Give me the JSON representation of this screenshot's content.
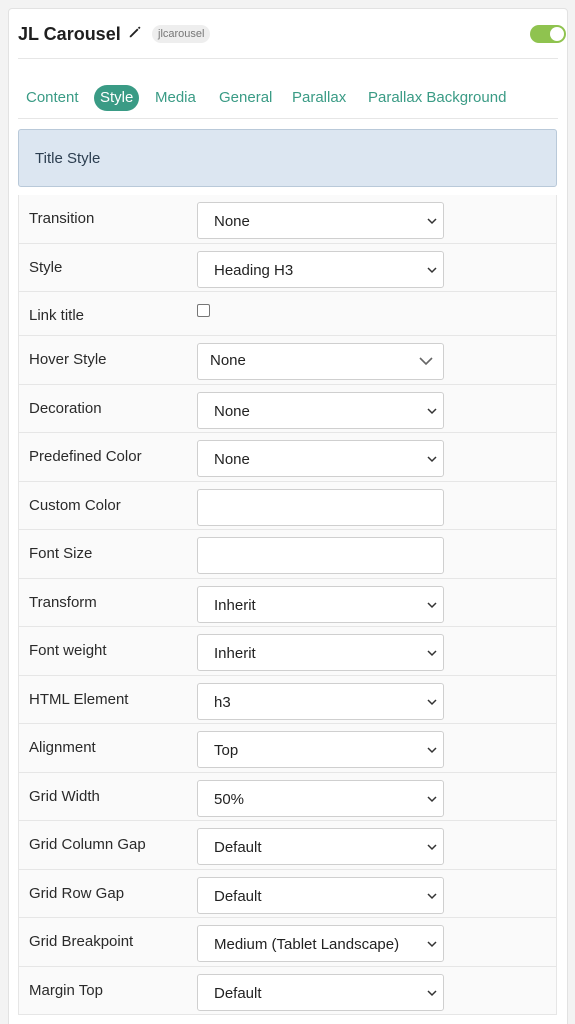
{
  "header": {
    "title": "JL Carousel",
    "alias": "jlcarousel",
    "enabled": true
  },
  "tabs": [
    {
      "label": "Content",
      "active": false
    },
    {
      "label": "Style",
      "active": true
    },
    {
      "label": "Media",
      "active": false
    },
    {
      "label": "General",
      "active": false
    },
    {
      "label": "Parallax",
      "active": false
    },
    {
      "label": "Parallax Background",
      "active": false
    }
  ],
  "section": {
    "title": "Title Style"
  },
  "fields": {
    "transition": {
      "label": "Transition",
      "value": "None"
    },
    "style": {
      "label": "Style",
      "value": "Heading H3"
    },
    "link_title": {
      "label": "Link title",
      "checked": false
    },
    "hover_style": {
      "label": "Hover Style",
      "value": "None"
    },
    "decoration": {
      "label": "Decoration",
      "value": "None"
    },
    "predefined_color": {
      "label": "Predefined Color",
      "value": "None"
    },
    "custom_color": {
      "label": "Custom Color",
      "value": ""
    },
    "font_size": {
      "label": "Font Size",
      "value": ""
    },
    "transform": {
      "label": "Transform",
      "value": "Inherit"
    },
    "font_weight": {
      "label": "Font weight",
      "value": "Inherit"
    },
    "html_element": {
      "label": "HTML Element",
      "value": "h3"
    },
    "alignment": {
      "label": "Alignment",
      "value": "Top"
    },
    "grid_width": {
      "label": "Grid Width",
      "value": "50%"
    },
    "grid_column_gap": {
      "label": "Grid Column Gap",
      "value": "Default"
    },
    "grid_row_gap": {
      "label": "Grid Row Gap",
      "value": "Default"
    },
    "grid_breakpoint": {
      "label": "Grid Breakpoint",
      "value": "Medium (Tablet Landscape)"
    },
    "margin_top": {
      "label": "Margin Top",
      "value": "Default"
    }
  },
  "colors": {
    "accent": "#3a9b85",
    "toggle_on": "#8fc34f",
    "section_bg": "#dce6f1"
  },
  "icons": {
    "edit": "pencil-icon",
    "dropdown": "chevron-down-icon"
  }
}
